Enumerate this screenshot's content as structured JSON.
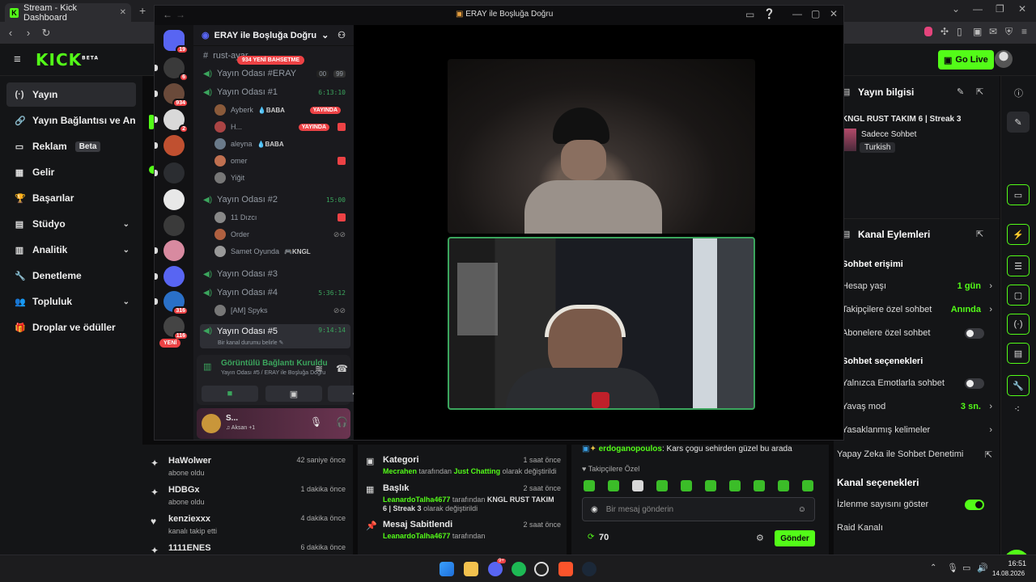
{
  "browser": {
    "tab_title": "Stream - Kick Dashboard",
    "tab_close": "✕",
    "new_tab": "+"
  },
  "kick": {
    "logo": "KICK",
    "logo_sup": "BETA",
    "go_live": "Go Live",
    "sidebar": [
      {
        "label": "Yayın",
        "icon": "broadcast-icon",
        "glyph": "(·)"
      },
      {
        "label": "Yayın Bağlantısı ve Anahtarı",
        "icon": "link-icon",
        "glyph": "🔗"
      },
      {
        "label": "Reklam",
        "icon": "ad-icon",
        "glyph": "▭",
        "badge": "Beta"
      },
      {
        "label": "Gelir",
        "icon": "revenue-icon",
        "glyph": "▦"
      },
      {
        "label": "Başarılar",
        "icon": "trophy-icon",
        "glyph": "🏆"
      },
      {
        "label": "Stüdyo",
        "icon": "studio-icon",
        "glyph": "▤"
      },
      {
        "label": "Analitik",
        "icon": "analytics-icon",
        "glyph": "▥"
      },
      {
        "label": "Denetleme",
        "icon": "wrench-icon",
        "glyph": "🔧"
      },
      {
        "label": "Topluluk",
        "icon": "community-icon",
        "glyph": "👥"
      },
      {
        "label": "Droplar ve ödüller",
        "icon": "gift-icon",
        "glyph": "🎁"
      }
    ],
    "stream_info": {
      "header": "Yayın bilgisi",
      "title": "KNGL RUST TAKIM 6 | Streak 3",
      "category": "Sadece Sohbet",
      "tag": "Turkish"
    },
    "channel_actions": {
      "header": "Kanal Eylemleri",
      "chat_access": "Sohbet erişimi",
      "account_age": {
        "label": "Hesap yaşı",
        "value": "1 gün"
      },
      "followers_only": {
        "label": "Takipçilere özel sohbet",
        "value": "Anında"
      },
      "subs_only": "Abonelere özel sohbet",
      "chat_options": "Sohbet seçenekleri",
      "emote_only": "Yalnızca Emotlarla sohbet",
      "slow_mode": {
        "label": "Yavaş mod",
        "value": "3 sn."
      },
      "banned_words": "Yasaklanmış kelimeler",
      "ai_moderation": "Yapay Zeka ile Sohbet Denetimi",
      "channel_options": "Kanal seçenekleri",
      "show_viewers": "İzlenme sayısını göster",
      "raid": "Raid Kanalı"
    },
    "events": [
      {
        "name": "HaWolwer",
        "time": "42 saniye önce",
        "sub": "abone oldu",
        "icon": "sparkle-icon",
        "glyph": "✦"
      },
      {
        "name": "HDBGx",
        "time": "1 dakika önce",
        "sub": "abone oldu",
        "icon": "sparkle-icon",
        "glyph": "✦"
      },
      {
        "name": "kenziexxx",
        "time": "4 dakika önce",
        "sub": "kanalı takip etti",
        "icon": "heart-icon",
        "glyph": "♥"
      },
      {
        "name": "1111ENES",
        "time": "6 dakika önce",
        "sub": "",
        "icon": "sparkle-icon",
        "glyph": "✦"
      }
    ],
    "changes": [
      {
        "name": "Kategori",
        "time": "1 saat önce",
        "icon": "category-icon",
        "glyph": "▣",
        "user": "Mecrahen",
        "mid": " tarafından ",
        "target": "Just Chatting",
        "end": " olarak değiştirildi"
      },
      {
        "name": "Başlık",
        "time": "2 saat önce",
        "icon": "title-icon",
        "glyph": "▦",
        "user": "LeanardoTalha4677",
        "mid": " tarafından ",
        "target": "KNGL RUST TAKIM 6 | Streak 3",
        "end": " olarak değiştirildi"
      },
      {
        "name": "Mesaj Sabitlendi",
        "time": "2 saat önce",
        "icon": "pin-icon",
        "glyph": "📌",
        "user": "LeanardoTalha4677",
        "mid": " tarafından",
        "target": "",
        "end": ""
      }
    ],
    "chat": {
      "username": "erdoganopoulos",
      "message": ": Kars çogu sehirden güzel bu arada",
      "followers_only": "♥ Takipçilere Özel",
      "placeholder": "Bir mesaj gönderin",
      "points": "70",
      "send": "Gönder"
    }
  },
  "discord": {
    "window_title": "ERAY ile Boşluğa Doğru",
    "server_name": "ERAY ile Boşluğa Doğru",
    "mention_badge": "934 YENİ BAHSETME",
    "new_badge": "YENİ",
    "guild_badges": [
      "19",
      "6",
      "9",
      "934",
      "2",
      "",
      "",
      "26",
      "",
      "316",
      "116"
    ],
    "channels": {
      "rust": "rust-ayar",
      "eray": "Yayın Odası #ERAY",
      "eray_counts": [
        "00",
        "99"
      ],
      "oda1": "Yayın Odası #1",
      "oda1_time": "6:13:10",
      "oda1_users": [
        {
          "name": "Ayberk",
          "role": "💧BABA",
          "live": "YAYINDA"
        },
        {
          "name": "H...",
          "role": "",
          "live": "YAYINDA"
        },
        {
          "name": "aleyna",
          "role": "💧BABA",
          "live": ""
        },
        {
          "name": "omer",
          "role": "",
          "live": ""
        },
        {
          "name": "Yiğit",
          "role": "",
          "live": ""
        }
      ],
      "oda2": "Yayın Odası #2",
      "oda2_time": "15:00",
      "oda2_users": [
        {
          "name": "11 Dızcı",
          "role": ""
        },
        {
          "name": "Order",
          "role": ""
        },
        {
          "name": "Samet Oyunda",
          "role": "🎮KNGL"
        }
      ],
      "oda3": "Yayın Odası #3",
      "oda4": "Yayın Odası #4",
      "oda4_time": "5:36:12",
      "oda4_users": [
        {
          "name": "[AM] Spyks"
        }
      ],
      "oda5": "Yayın Odası #5",
      "oda5_time": "9:14:14",
      "oda5_status": "Bir kanal durumu belirle ✎"
    },
    "voice": {
      "status": "Görüntülü Bağlantı Kuruldu",
      "sub": "Yayın Odası #5 / ERAY ile Boşluğa Doğru"
    },
    "user": {
      "name": "S...",
      "status": "♫ Aksan +1"
    }
  },
  "taskbar": {
    "time": "16:51",
    "date": "14.08.2026",
    "discord_badge": "9+"
  },
  "colors": {
    "kick_green": "#53fc18",
    "discord_green": "#3ba55d",
    "discord_red": "#ed4245"
  }
}
